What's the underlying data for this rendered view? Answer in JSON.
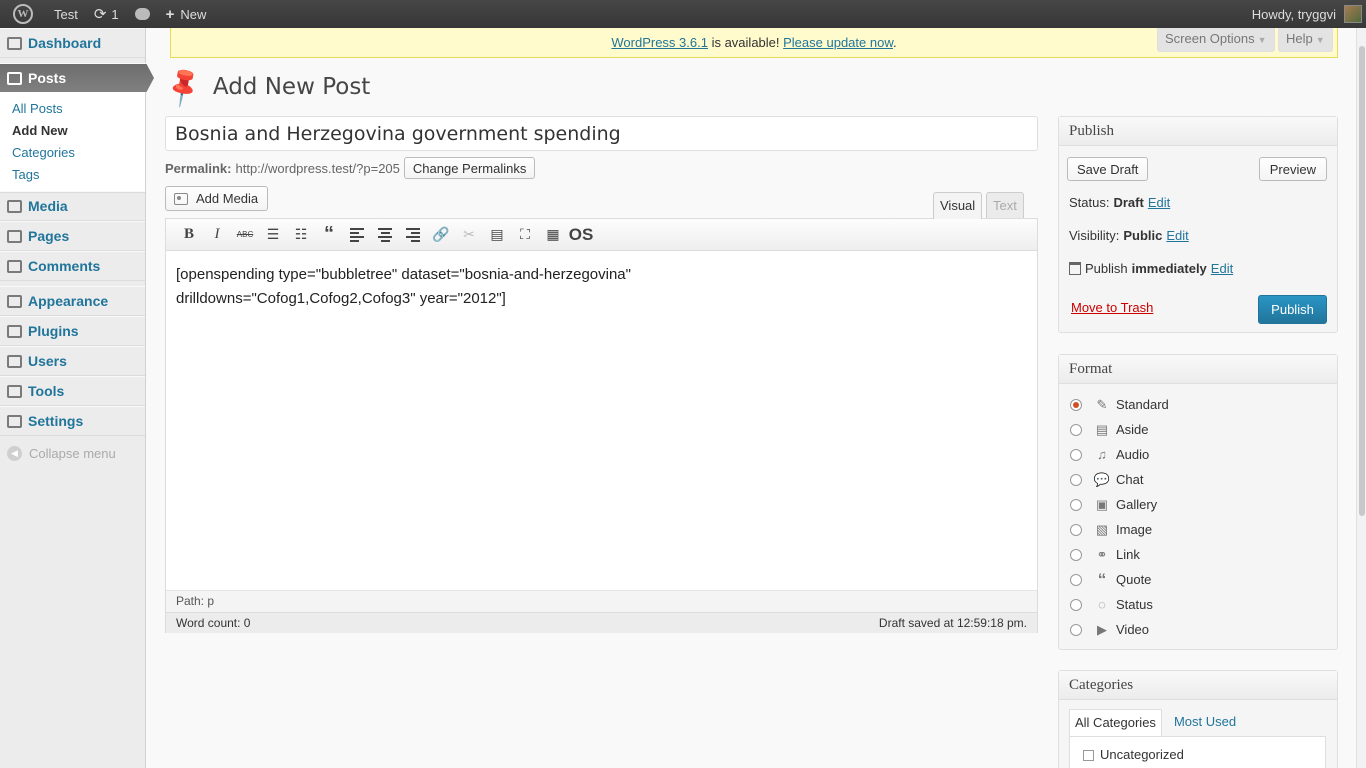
{
  "adminbar": {
    "site_name": "Test",
    "updates_count": "1",
    "new_label": "New",
    "howdy": "Howdy, tryggvi"
  },
  "sidebar": {
    "items": [
      {
        "label": "Dashboard",
        "icon": "dashboard-icon"
      },
      {
        "label": "Posts",
        "icon": "pushpin-icon"
      },
      {
        "label": "Media",
        "icon": "media-icon"
      },
      {
        "label": "Pages",
        "icon": "pages-icon"
      },
      {
        "label": "Comments",
        "icon": "comments-icon"
      },
      {
        "label": "Appearance",
        "icon": "appearance-icon"
      },
      {
        "label": "Plugins",
        "icon": "plugins-icon"
      },
      {
        "label": "Users",
        "icon": "users-icon"
      },
      {
        "label": "Tools",
        "icon": "tools-icon"
      },
      {
        "label": "Settings",
        "icon": "settings-icon"
      }
    ],
    "posts_submenu": [
      "All Posts",
      "Add New",
      "Categories",
      "Tags"
    ],
    "collapse_label": "Collapse menu"
  },
  "notice": {
    "link_version": "WordPress 3.6.1",
    "middle_text": " is available! ",
    "link_update": "Please update now",
    "end": "."
  },
  "screen_options_label": "Screen Options",
  "help_label": "Help",
  "page": {
    "title": "Add New Post",
    "post_title": "Bosnia and Herzegovina government spending",
    "permalink_label": "Permalink:",
    "permalink_url": "http://wordpress.test/?p=205",
    "change_permalinks": "Change Permalinks",
    "add_media": "Add Media"
  },
  "editor": {
    "tabs": [
      "Visual",
      "Text"
    ],
    "content_line1": "[openspending type=\"bubbletree\" dataset=\"bosnia-and-herzegovina\"",
    "content_line2": "drilldowns=\"Cofog1,Cofog2,Cofog3\" year=\"2012\"]",
    "path": "Path: p",
    "word_count": "Word count: 0",
    "draft_saved": "Draft saved at 12:59:18 pm."
  },
  "publish": {
    "heading": "Publish",
    "save_draft": "Save Draft",
    "preview": "Preview",
    "status_label": "Status:",
    "status_value": "Draft",
    "visibility_label": "Visibility:",
    "visibility_value": "Public",
    "publish_label": "Publish",
    "publish_value": "immediately",
    "edit": "Edit",
    "trash": "Move to Trash",
    "publish_button": "Publish",
    "accent_color": "#21759b"
  },
  "format": {
    "heading": "Format",
    "options": [
      {
        "label": "Standard",
        "icon": "pushpin-icon",
        "checked": true
      },
      {
        "label": "Aside",
        "icon": "aside-icon",
        "checked": false
      },
      {
        "label": "Audio",
        "icon": "music-note-icon",
        "checked": false
      },
      {
        "label": "Chat",
        "icon": "chat-bubbles-icon",
        "checked": false
      },
      {
        "label": "Gallery",
        "icon": "gallery-icon",
        "checked": false
      },
      {
        "label": "Image",
        "icon": "image-icon",
        "checked": false
      },
      {
        "label": "Link",
        "icon": "link-icon",
        "checked": false
      },
      {
        "label": "Quote",
        "icon": "quote-icon",
        "checked": false
      },
      {
        "label": "Status",
        "icon": "status-icon",
        "checked": false
      },
      {
        "label": "Video",
        "icon": "video-icon",
        "checked": false
      }
    ]
  },
  "categories": {
    "heading": "Categories",
    "tab_all": "All Categories",
    "tab_most_used": "Most Used",
    "items": [
      "Uncategorized"
    ]
  }
}
